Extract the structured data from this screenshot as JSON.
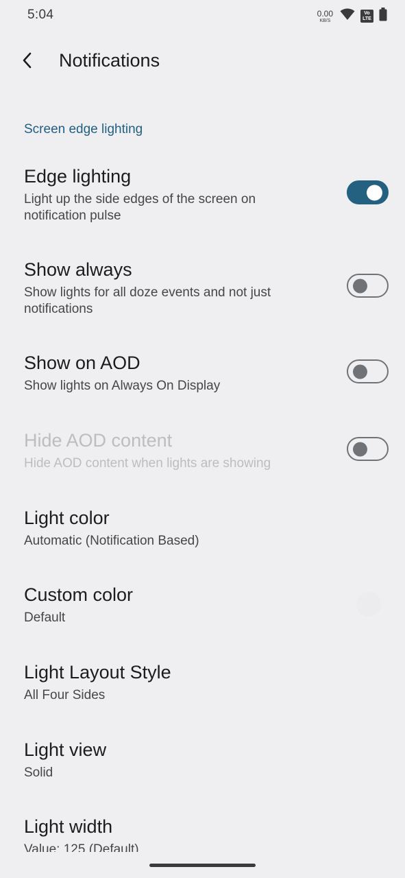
{
  "status_bar": {
    "time": "5:04",
    "net_speed_value": "0.00",
    "net_speed_unit": "KB/S",
    "volte_top": "Vo",
    "volte_bottom": "LTE"
  },
  "header": {
    "title": "Notifications"
  },
  "section": {
    "label": "Screen edge lighting"
  },
  "prefs": [
    {
      "title": "Edge lighting",
      "summary": "Light up the side edges of the screen on notification pulse",
      "switch": "on"
    },
    {
      "title": "Show always",
      "summary": "Show lights for all doze events and not just notifications",
      "switch": "off"
    },
    {
      "title": "Show on AOD",
      "summary": "Show lights on Always On Display",
      "switch": "off"
    },
    {
      "title": "Hide AOD content",
      "summary": "Hide AOD content when lights are showing",
      "switch": "off",
      "disabled": true
    },
    {
      "title": "Light color",
      "summary": "Automatic (Notification Based)"
    },
    {
      "title": "Custom color",
      "summary": "Default"
    },
    {
      "title": "Light Layout Style",
      "summary": "All Four Sides"
    },
    {
      "title": "Light view",
      "summary": "Solid"
    },
    {
      "title": "Light width",
      "summary": "Value: 125 (Default)"
    }
  ],
  "icons": {
    "back": "chevron-left-icon",
    "wifi": "wifi-icon",
    "battery": "battery-icon"
  },
  "colors": {
    "accent": "#225f80",
    "switch_on": "#24607f",
    "background": "#efeff1"
  }
}
